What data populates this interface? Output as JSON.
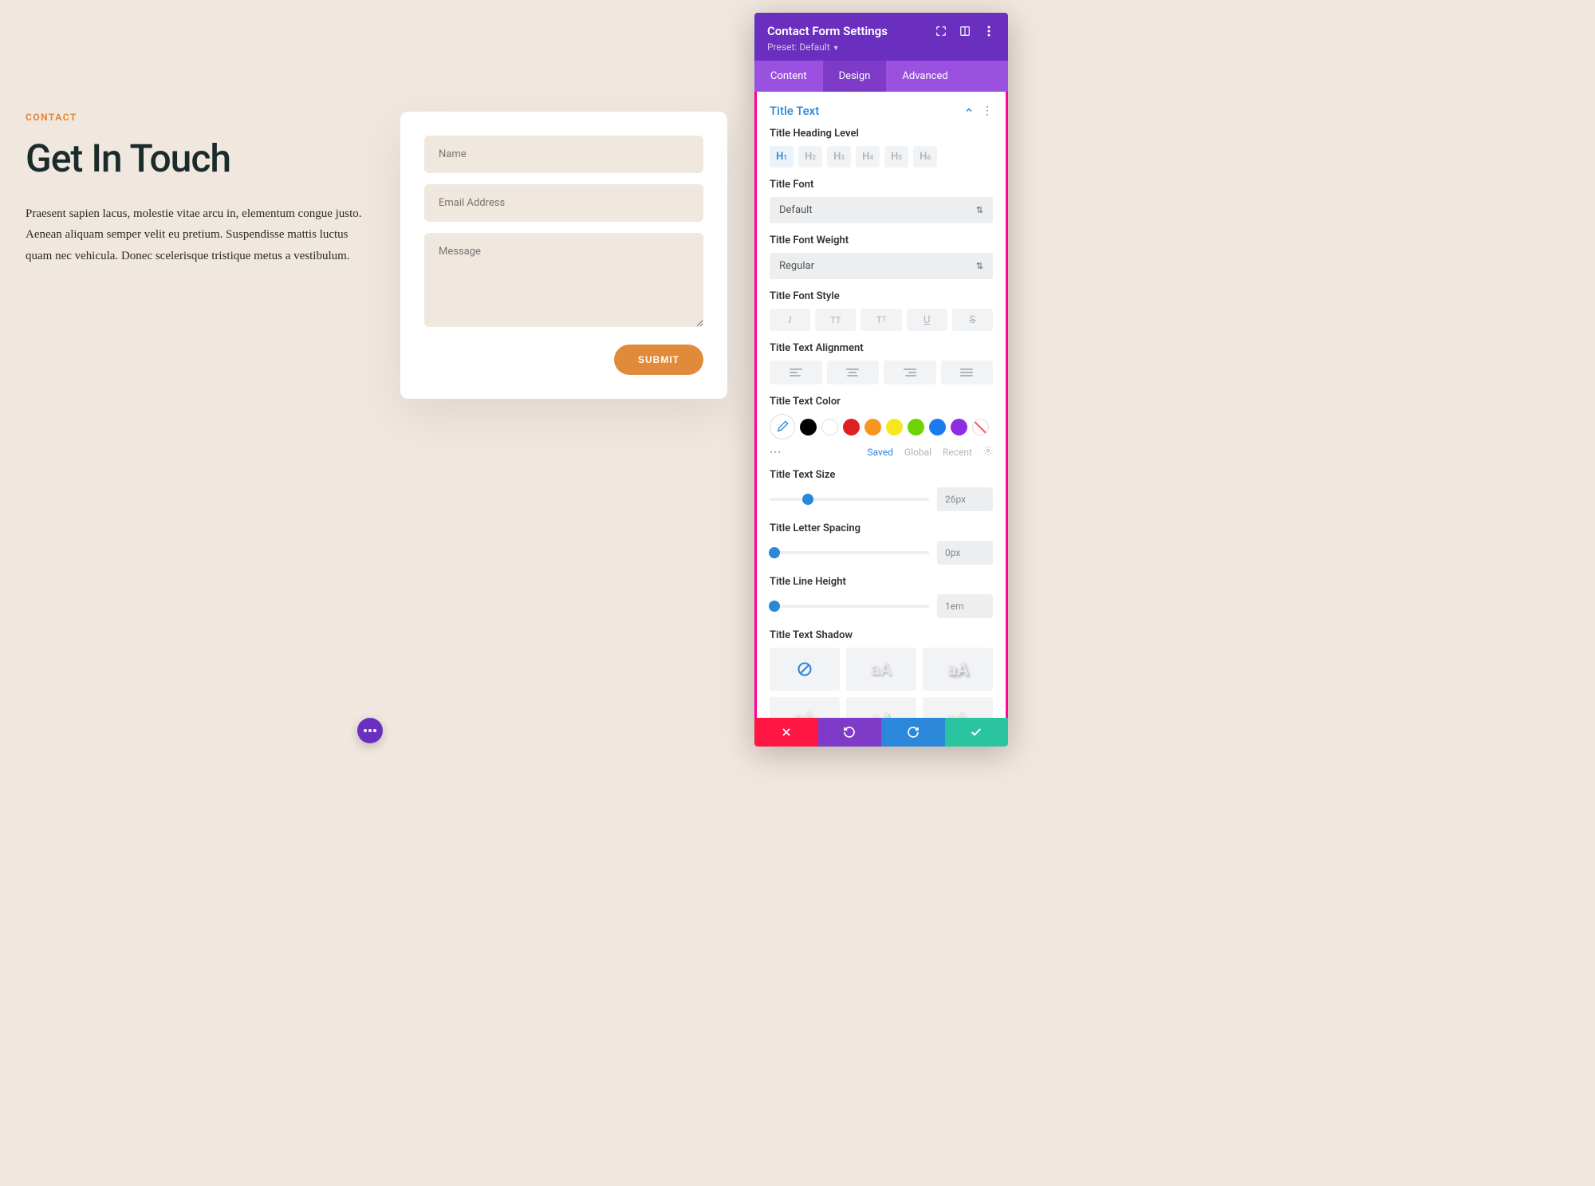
{
  "page": {
    "eyebrow": "CONTACT",
    "title": "Get In Touch",
    "body": "Praesent sapien lacus, molestie vitae arcu in, elementum congue justo. Aenean aliquam semper velit eu pretium. Suspendisse mattis luctus quam nec vehicula. Donec scelerisque tristique metus a vestibulum."
  },
  "form": {
    "name_placeholder": "Name",
    "email_placeholder": "Email Address",
    "message_placeholder": "Message",
    "submit_label": "SUBMIT"
  },
  "panel": {
    "title": "Contact Form Settings",
    "preset_label": "Preset: Default",
    "tabs": {
      "content": "Content",
      "design": "Design",
      "advanced": "Advanced"
    },
    "section_title": "Title Text",
    "controls": {
      "heading_level_label": "Title Heading Level",
      "heading_levels": [
        "H1",
        "H2",
        "H3",
        "H4",
        "H5",
        "H6"
      ],
      "heading_active": "H1",
      "font_label": "Title Font",
      "font_value": "Default",
      "font_weight_label": "Title Font Weight",
      "font_weight_value": "Regular",
      "font_style_label": "Title Font Style",
      "alignment_label": "Title Text Alignment",
      "text_color_label": "Title Text Color",
      "color_swatches": [
        "#000000",
        "#ffffff",
        "#e02020",
        "#f7961e",
        "#f8e71c",
        "#6dd400",
        "#1a7af0",
        "#8e2de2"
      ],
      "color_tabs": {
        "saved": "Saved",
        "global": "Global",
        "recent": "Recent"
      },
      "text_size_label": "Title Text Size",
      "text_size_value": "26px",
      "text_size_pct": 24,
      "letter_spacing_label": "Title Letter Spacing",
      "letter_spacing_value": "0px",
      "letter_spacing_pct": 3,
      "line_height_label": "Title Line Height",
      "line_height_value": "1em",
      "line_height_pct": 3,
      "text_shadow_label": "Title Text Shadow",
      "shadow_sample": "aA"
    }
  }
}
